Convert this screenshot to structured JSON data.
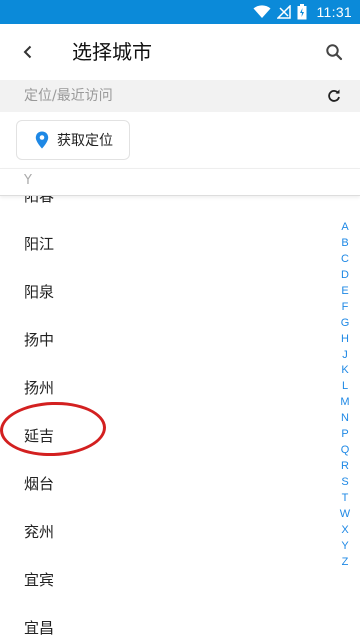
{
  "status_bar": {
    "time": "11:31"
  },
  "header": {
    "title": "选择城市"
  },
  "recent": {
    "label": "定位/最近访问",
    "locate_label": "获取定位"
  },
  "section": {
    "letter": "Y"
  },
  "cities": [
    "阳春",
    "阳江",
    "阳泉",
    "扬中",
    "扬州",
    "延吉",
    "烟台",
    "兖州",
    "宜宾",
    "宜昌"
  ],
  "alphabet": [
    "A",
    "B",
    "C",
    "D",
    "E",
    "F",
    "G",
    "H",
    "J",
    "K",
    "L",
    "M",
    "N",
    "P",
    "Q",
    "R",
    "S",
    "T",
    "W",
    "X",
    "Y",
    "Z"
  ],
  "colors": {
    "status_bar": "#0b8ad9",
    "accent": "#1e88e5",
    "highlight": "#d32020"
  },
  "icons": {
    "back": "chevron-left-icon",
    "search": "search-icon",
    "refresh": "refresh-icon",
    "locate": "location-pin-icon"
  }
}
